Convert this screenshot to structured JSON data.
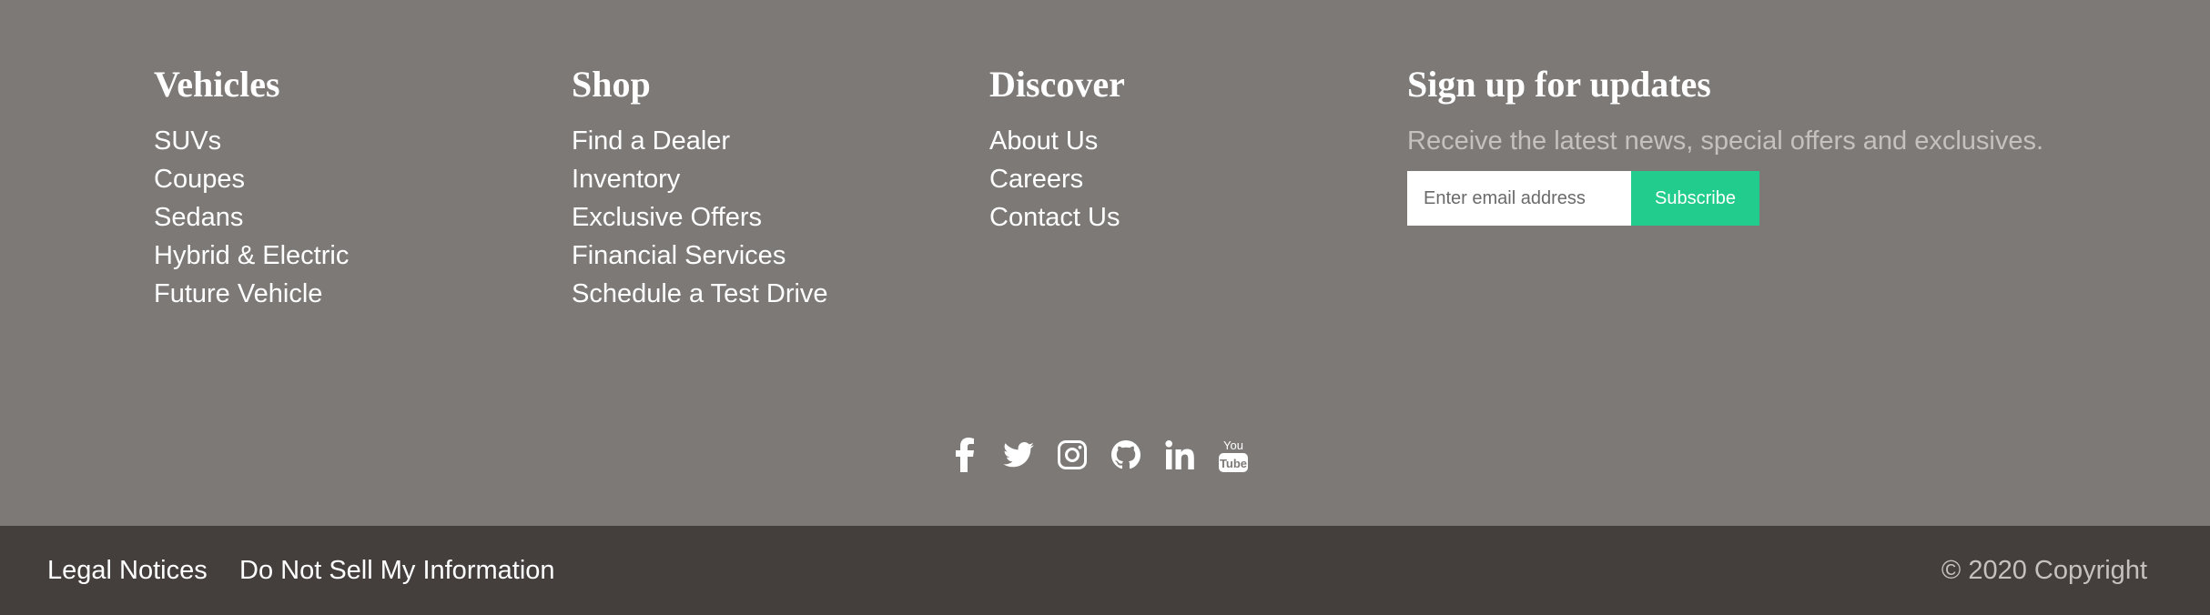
{
  "columns": {
    "vehicles": {
      "heading": "Vehicles",
      "links": [
        "SUVs",
        "Coupes",
        "Sedans",
        "Hybrid & Electric",
        "Future Vehicle"
      ]
    },
    "shop": {
      "heading": "Shop",
      "links": [
        "Find a Dealer",
        "Inventory",
        "Exclusive Offers",
        "Financial Services",
        "Schedule a Test Drive"
      ]
    },
    "discover": {
      "heading": "Discover",
      "links": [
        "About Us",
        "Careers",
        "Contact Us"
      ]
    }
  },
  "signup": {
    "heading": "Sign up for updates",
    "description": "Receive the latest news, special offers and exclusives.",
    "email_placeholder": "Enter email address",
    "subscribe_label": "Subscribe"
  },
  "social": [
    "facebook-icon",
    "twitter-icon",
    "instagram-icon",
    "github-icon",
    "linkedin-icon",
    "youtube-icon"
  ],
  "bottom_bar": {
    "legal_notices": "Legal Notices",
    "do_not_sell": "Do Not Sell My Information",
    "copyright": "© 2020 Copyright"
  },
  "colors": {
    "footer_bg": "#7d7977",
    "bottom_bar_bg": "#443f3d",
    "accent": "#21cc8c",
    "muted_text": "#c4c1bf"
  }
}
